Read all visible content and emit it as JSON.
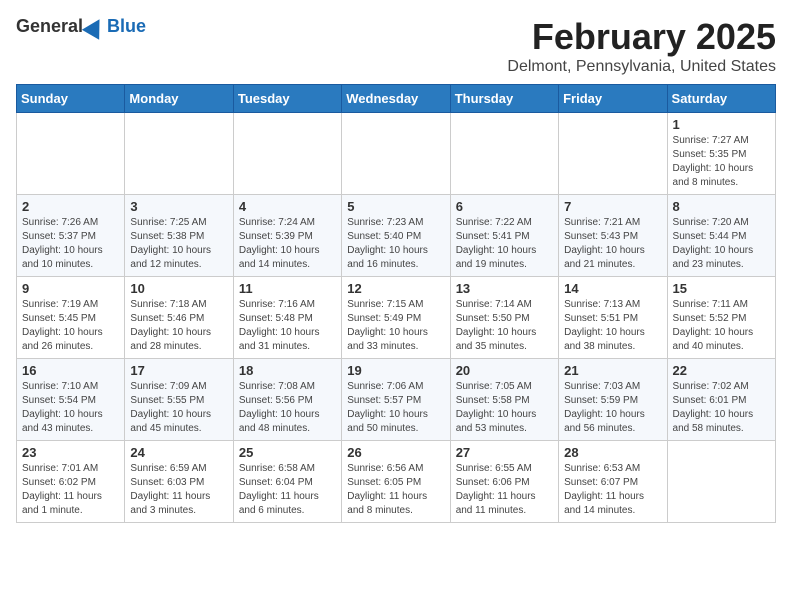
{
  "header": {
    "logo_general": "General",
    "logo_blue": "Blue",
    "month_title": "February 2025",
    "location": "Delmont, Pennsylvania, United States"
  },
  "days_of_week": [
    "Sunday",
    "Monday",
    "Tuesday",
    "Wednesday",
    "Thursday",
    "Friday",
    "Saturday"
  ],
  "weeks": [
    [
      {
        "day": "",
        "info": ""
      },
      {
        "day": "",
        "info": ""
      },
      {
        "day": "",
        "info": ""
      },
      {
        "day": "",
        "info": ""
      },
      {
        "day": "",
        "info": ""
      },
      {
        "day": "",
        "info": ""
      },
      {
        "day": "1",
        "info": "Sunrise: 7:27 AM\nSunset: 5:35 PM\nDaylight: 10 hours and 8 minutes."
      }
    ],
    [
      {
        "day": "2",
        "info": "Sunrise: 7:26 AM\nSunset: 5:37 PM\nDaylight: 10 hours and 10 minutes."
      },
      {
        "day": "3",
        "info": "Sunrise: 7:25 AM\nSunset: 5:38 PM\nDaylight: 10 hours and 12 minutes."
      },
      {
        "day": "4",
        "info": "Sunrise: 7:24 AM\nSunset: 5:39 PM\nDaylight: 10 hours and 14 minutes."
      },
      {
        "day": "5",
        "info": "Sunrise: 7:23 AM\nSunset: 5:40 PM\nDaylight: 10 hours and 16 minutes."
      },
      {
        "day": "6",
        "info": "Sunrise: 7:22 AM\nSunset: 5:41 PM\nDaylight: 10 hours and 19 minutes."
      },
      {
        "day": "7",
        "info": "Sunrise: 7:21 AM\nSunset: 5:43 PM\nDaylight: 10 hours and 21 minutes."
      },
      {
        "day": "8",
        "info": "Sunrise: 7:20 AM\nSunset: 5:44 PM\nDaylight: 10 hours and 23 minutes."
      }
    ],
    [
      {
        "day": "9",
        "info": "Sunrise: 7:19 AM\nSunset: 5:45 PM\nDaylight: 10 hours and 26 minutes."
      },
      {
        "day": "10",
        "info": "Sunrise: 7:18 AM\nSunset: 5:46 PM\nDaylight: 10 hours and 28 minutes."
      },
      {
        "day": "11",
        "info": "Sunrise: 7:16 AM\nSunset: 5:48 PM\nDaylight: 10 hours and 31 minutes."
      },
      {
        "day": "12",
        "info": "Sunrise: 7:15 AM\nSunset: 5:49 PM\nDaylight: 10 hours and 33 minutes."
      },
      {
        "day": "13",
        "info": "Sunrise: 7:14 AM\nSunset: 5:50 PM\nDaylight: 10 hours and 35 minutes."
      },
      {
        "day": "14",
        "info": "Sunrise: 7:13 AM\nSunset: 5:51 PM\nDaylight: 10 hours and 38 minutes."
      },
      {
        "day": "15",
        "info": "Sunrise: 7:11 AM\nSunset: 5:52 PM\nDaylight: 10 hours and 40 minutes."
      }
    ],
    [
      {
        "day": "16",
        "info": "Sunrise: 7:10 AM\nSunset: 5:54 PM\nDaylight: 10 hours and 43 minutes."
      },
      {
        "day": "17",
        "info": "Sunrise: 7:09 AM\nSunset: 5:55 PM\nDaylight: 10 hours and 45 minutes."
      },
      {
        "day": "18",
        "info": "Sunrise: 7:08 AM\nSunset: 5:56 PM\nDaylight: 10 hours and 48 minutes."
      },
      {
        "day": "19",
        "info": "Sunrise: 7:06 AM\nSunset: 5:57 PM\nDaylight: 10 hours and 50 minutes."
      },
      {
        "day": "20",
        "info": "Sunrise: 7:05 AM\nSunset: 5:58 PM\nDaylight: 10 hours and 53 minutes."
      },
      {
        "day": "21",
        "info": "Sunrise: 7:03 AM\nSunset: 5:59 PM\nDaylight: 10 hours and 56 minutes."
      },
      {
        "day": "22",
        "info": "Sunrise: 7:02 AM\nSunset: 6:01 PM\nDaylight: 10 hours and 58 minutes."
      }
    ],
    [
      {
        "day": "23",
        "info": "Sunrise: 7:01 AM\nSunset: 6:02 PM\nDaylight: 11 hours and 1 minute."
      },
      {
        "day": "24",
        "info": "Sunrise: 6:59 AM\nSunset: 6:03 PM\nDaylight: 11 hours and 3 minutes."
      },
      {
        "day": "25",
        "info": "Sunrise: 6:58 AM\nSunset: 6:04 PM\nDaylight: 11 hours and 6 minutes."
      },
      {
        "day": "26",
        "info": "Sunrise: 6:56 AM\nSunset: 6:05 PM\nDaylight: 11 hours and 8 minutes."
      },
      {
        "day": "27",
        "info": "Sunrise: 6:55 AM\nSunset: 6:06 PM\nDaylight: 11 hours and 11 minutes."
      },
      {
        "day": "28",
        "info": "Sunrise: 6:53 AM\nSunset: 6:07 PM\nDaylight: 11 hours and 14 minutes."
      },
      {
        "day": "",
        "info": ""
      }
    ]
  ]
}
